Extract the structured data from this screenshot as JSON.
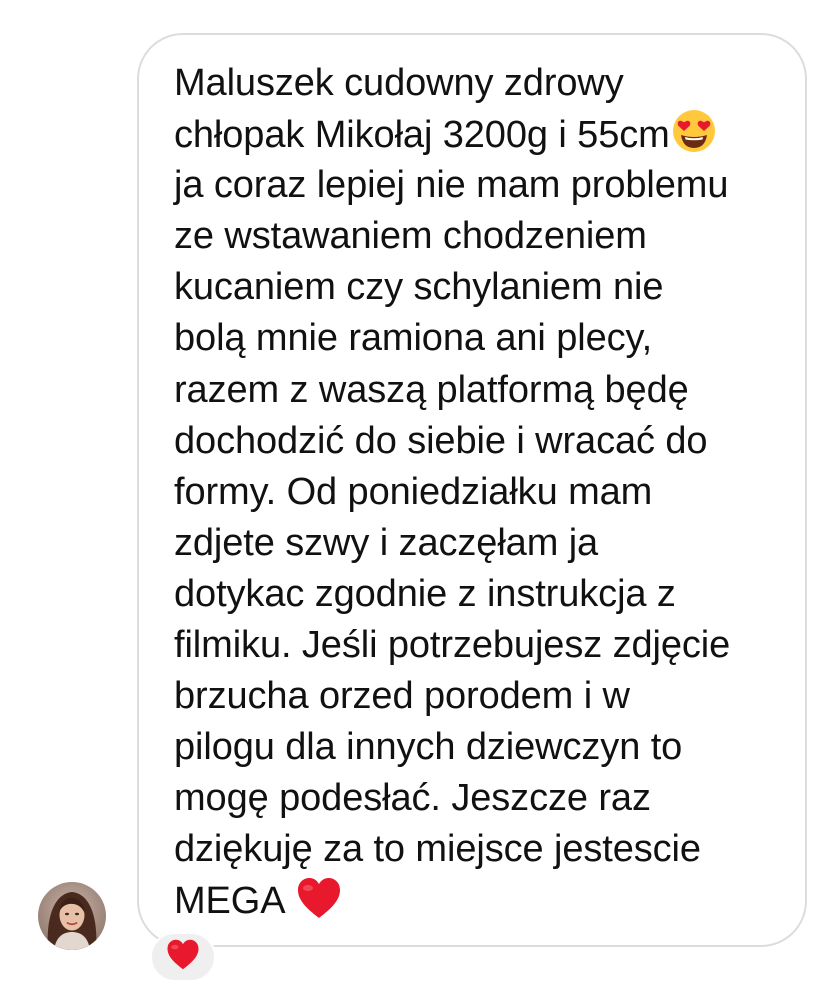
{
  "message": {
    "lines": [
      "Maluszek cudowny zdrowy",
      "chłopak Mikołaj 3200g i 55cm",
      "ja coraz lepiej nie mam problemu",
      "ze wstawaniem chodzeniem",
      "kucaniem czy schylaniem nie",
      "bolą mnie ramiona ani plecy,",
      "razem z waszą platformą będę",
      "dochodzić do siebie i wracać do",
      "formy. Od poniedziałku mam",
      "zdjete szwy i zaczęłam ja",
      "dotykac zgodnie z instrukcja z",
      "filmiku. Jeśli potrzebujesz zdjęcie",
      "brzucha orzed porodem i w",
      "pilogu dla innych dziewczyn to",
      "mogę podesłać. Jeszcze raz",
      "dziękuję za to miejsce jestescie",
      "MEGA"
    ],
    "inline_emojis": [
      "heart-eyes-emoji",
      "red-heart-emoji"
    ]
  },
  "reaction": {
    "emoji": "red-heart-emoji"
  },
  "colors": {
    "bubble_border": "#dcdcdc",
    "text": "#111111",
    "reaction_bg": "#efefef",
    "heart": "#e8192c",
    "emoji_face": "#ffc83d"
  }
}
